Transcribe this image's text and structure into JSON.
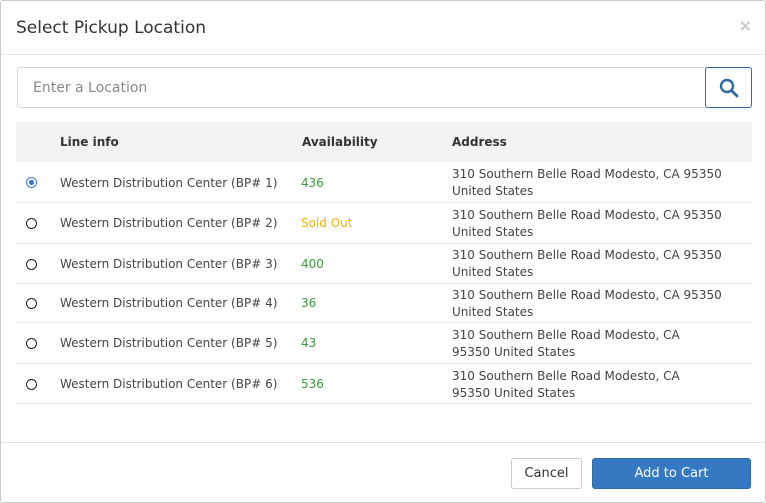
{
  "modal": {
    "title": "Select Pickup Location",
    "close_label": "×"
  },
  "search": {
    "placeholder": "Enter a Location",
    "value": "",
    "icon": "search-icon"
  },
  "table": {
    "columns": [
      "Line info",
      "Availability",
      "Address"
    ],
    "rows": [
      {
        "line_info": "Western Distribution Center (BP# 1)",
        "availability": "436",
        "address": "310 Southern Belle Road Modesto, CA 95350 United States",
        "selected": true
      },
      {
        "line_info": "Western Distribution Center (BP# 2)",
        "availability": "Sold Out",
        "address": "310 Southern Belle Road Modesto, CA 95350 United States",
        "selected": false
      },
      {
        "line_info": "Western Distribution Center (BP# 3)",
        "availability": "400",
        "address": "310 Southern Belle Road Modesto, CA 95350 United States",
        "selected": false
      },
      {
        "line_info": "Western Distribution Center (BP# 4)",
        "availability": "36",
        "address": "310 Southern Belle Road Modesto, CA 95350 United States",
        "selected": false
      },
      {
        "line_info": "Western Distribution Center (BP# 5)",
        "availability": "43",
        "address": "310 Southern Belle Road Modesto, CA 95350 United States",
        "selected": false
      },
      {
        "line_info": "Western Distribution Center (BP# 6)",
        "availability": "536",
        "address": "310 Southern Belle Road Modesto, CA 95350 United States",
        "selected": false
      }
    ]
  },
  "footer": {
    "cancel_label": "Cancel",
    "add_label": "Add to Cart"
  },
  "colors": {
    "primary": "#3579c2",
    "in_stock": "#3c9a3c",
    "sold_out": "#f0b400",
    "header_bg": "#f2f2f2"
  }
}
